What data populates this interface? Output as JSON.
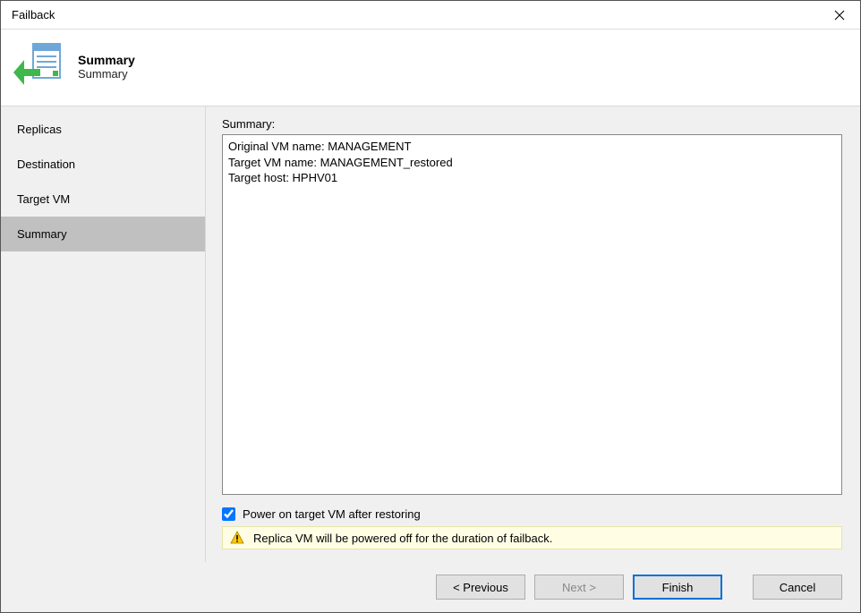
{
  "window": {
    "title": "Failback"
  },
  "header": {
    "title": "Summary",
    "subtitle": "Summary"
  },
  "sidebar": {
    "items": [
      {
        "label": "Replicas",
        "active": false
      },
      {
        "label": "Destination",
        "active": false
      },
      {
        "label": "Target VM",
        "active": false
      },
      {
        "label": "Summary",
        "active": true
      }
    ]
  },
  "content": {
    "summary_label": "Summary:",
    "summary_text": "Original VM name: MANAGEMENT\nTarget VM name: MANAGEMENT_restored\nTarget host: HPHV01",
    "power_on_checkbox_label": "Power on target VM after restoring",
    "power_on_checked": true,
    "warning_text": "Replica VM will be powered off for the duration of failback."
  },
  "footer": {
    "previous": "< Previous",
    "next": "Next >",
    "finish": "Finish",
    "cancel": "Cancel"
  }
}
